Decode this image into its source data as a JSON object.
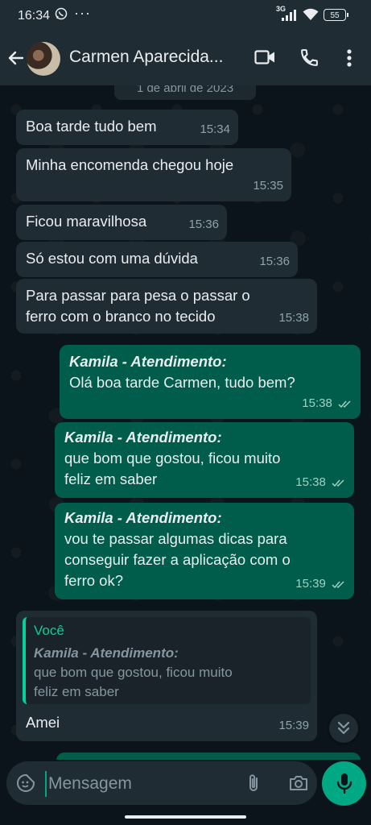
{
  "status_bar": {
    "time": "16:34",
    "network": "3G",
    "battery": "55"
  },
  "header": {
    "contact_name": "Carmen Aparecida..."
  },
  "chat": {
    "date_label": "1 de abril de 2023",
    "messages": [
      {
        "dir": "in",
        "text": "Boa tarde tudo bem",
        "time": "15:34"
      },
      {
        "dir": "in",
        "text": "Minha  encomenda chegou hoje",
        "time": "15:35"
      },
      {
        "dir": "in",
        "text": "Ficou maravilhosa",
        "time": "15:36"
      },
      {
        "dir": "in",
        "text": "Só estou  com uma  dúvida",
        "time": "15:36"
      },
      {
        "dir": "in",
        "line1": "Para  passar para pesa o passar o",
        "line2": "ferro com o branco  no tecido",
        "time": "15:38"
      },
      {
        "dir": "out",
        "author": "Kamila - Atendimento:",
        "text": "Olá boa tarde Carmen, tudo bem?",
        "time": "15:38"
      },
      {
        "dir": "out",
        "author": "Kamila - Atendimento:",
        "line1": "que bom que gostou, ficou muito",
        "line2": "feliz em saber",
        "time": "15:38"
      },
      {
        "dir": "out",
        "author": "Kamila - Atendimento:",
        "line1": "vou te passar algumas dicas para",
        "line2": "conseguir fazer a aplicação com o",
        "line3": "ferro ok?",
        "time": "15:39"
      },
      {
        "dir": "in",
        "quote_who": "Você",
        "quote_author": "Kamila - Atendimento:",
        "quote_line1": "que bom que gostou, ficou muito",
        "quote_line2": "feliz em saber",
        "text": "Amei",
        "time": "15:39"
      }
    ]
  },
  "composer": {
    "placeholder": "Mensagem"
  },
  "colors": {
    "outgoing": "#005c4b",
    "incoming": "#202c33",
    "accent": "#00a884",
    "background": "#0b141a"
  },
  "icons": [
    "back-arrow-icon",
    "video-call-icon",
    "phone-icon",
    "more-vert-icon",
    "sticker-icon",
    "attach-icon",
    "camera-icon",
    "mic-icon",
    "double-chevron-down-icon",
    "read-ticks-icon"
  ]
}
